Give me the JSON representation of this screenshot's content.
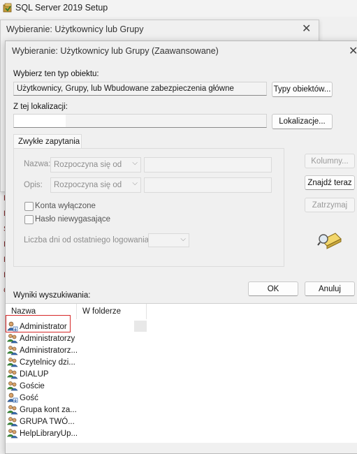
{
  "app": {
    "title": "SQL Server 2019 Setup"
  },
  "dialog_back": {
    "title": "Wybieranie: Użytkownicy lub Grupy"
  },
  "dialog": {
    "title": "Wybieranie: Użytkownicy lub Grupy (Zaawansowane)",
    "object_type_label": "Wybierz ten typ obiektu:",
    "object_type_value": "Użytkownicy, Grupy, lub Wbudowane zabezpieczenia główne",
    "object_types_button": "Typy obiektów...",
    "location_label": "Z tej lokalizacji:",
    "location_value": "",
    "locations_button": "Lokalizacje...",
    "tab_label": "Zwykłe zapytania",
    "name_label": "Nazwa:",
    "name_mode": "Rozpoczyna się od",
    "desc_label": "Opis:",
    "desc_mode": "Rozpoczyna się od",
    "disabled_accounts": "Konta wyłączone",
    "non_expiring": "Hasło niewygasające",
    "days_since_logon": "Liczba dni od ostatniego logowania:",
    "columns_button": "Kolumny...",
    "find_now_button": "Znajdź teraz",
    "stop_button": "Zatrzymaj",
    "ok_button": "OK",
    "cancel_button": "Anuluj",
    "results_label": "Wyniki wyszukiwania:",
    "columns": [
      "Nazwa",
      "W folderze"
    ],
    "results": [
      {
        "name": "Administrator",
        "icon": "user-icon"
      },
      {
        "name": "Administratorzy",
        "icon": "group-icon"
      },
      {
        "name": "Administratorz...",
        "icon": "group-icon"
      },
      {
        "name": "Czytelnicy dzi...",
        "icon": "group-icon"
      },
      {
        "name": "DIALUP",
        "icon": "group-icon"
      },
      {
        "name": "Goście",
        "icon": "group-icon"
      },
      {
        "name": "Gość",
        "icon": "user-icon"
      },
      {
        "name": "Grupa kont za...",
        "icon": "group-icon"
      },
      {
        "name": "GRUPA TWÓ...",
        "icon": "group-icon"
      },
      {
        "name": "HelpLibraryUp...",
        "icon": "group-icon"
      }
    ]
  },
  "colors": {
    "highlight_border": "#d62828",
    "accent": "#0067c0"
  }
}
